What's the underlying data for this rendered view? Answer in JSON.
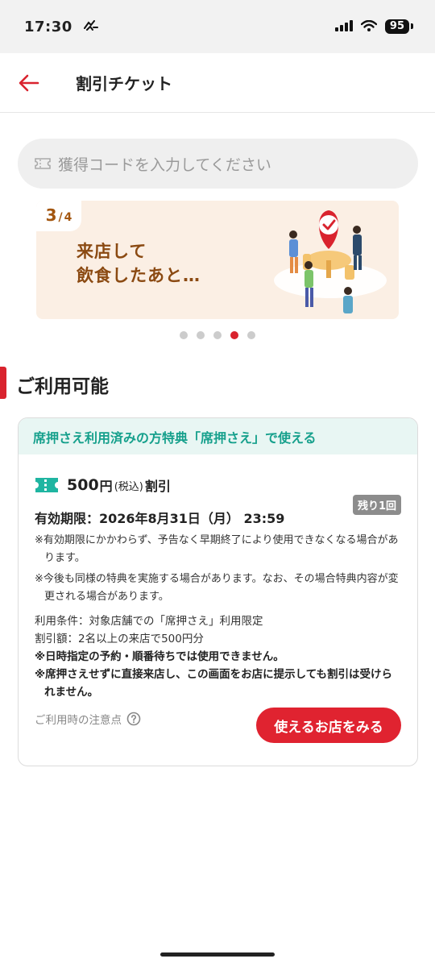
{
  "status_bar": {
    "time": "17:30",
    "battery": "95"
  },
  "header": {
    "title": "割引チケット"
  },
  "search": {
    "placeholder": "獲得コードを入力してください"
  },
  "banner": {
    "page_current": "3",
    "page_total": "4",
    "line1": "来店して",
    "line2": "飲食したあと…",
    "dots_total": 5,
    "dots_active_index": 3
  },
  "section": {
    "title": "ご利用可能"
  },
  "coupon": {
    "header": "席押さえ利用済みの方特典「席押さえ」で使える",
    "amount": "500",
    "yen": "円",
    "tax": "(税込)",
    "discount": "割引",
    "remaining": "残り1回",
    "expiry": "有効期限：2026年8月31日（月） 23:59",
    "notes": [
      "※有効期限にかかわらず、予告なく早期終了により使用できなくなる場合があります。",
      "※今後も同様の特典を実施する場合があります。なお、その場合特典内容が変更される場合があります。"
    ],
    "conditions": [
      "利用条件：対象店舗での「席押さえ」利用限定",
      "割引額：2名以上の来店で500円分"
    ],
    "bold_notes": [
      "※日時指定の予約・順番待ちでは使用できません。",
      "※席押さえせずに直接来店し、この画面をお店に提示しても割引は受けられません。"
    ],
    "caution_label": "ご利用時の注意点",
    "shop_button": "使えるお店をみる"
  },
  "colors": {
    "accent_red": "#d9232e",
    "teal": "#16a08c",
    "banner_bg": "#fbefe4",
    "banner_text": "#8b4a12"
  },
  "icons": [
    "back-arrow-icon",
    "ticket-icon",
    "question-circle-icon",
    "signal-icon",
    "wifi-icon",
    "battery-icon"
  ]
}
